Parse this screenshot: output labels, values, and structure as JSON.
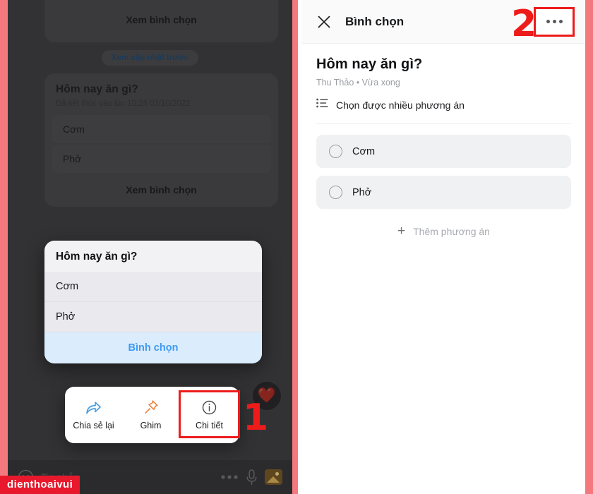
{
  "annotations": {
    "step_one": "1",
    "step_two": "2",
    "accent_color": "#ee1b1b"
  },
  "watermark": {
    "text": "dienthoaivui",
    "bg": "#e8192c",
    "fg": "#ffffff"
  },
  "left_panel": {
    "theme": "dark-dimmed",
    "background": "#323234",
    "top_card": {
      "action_label": "Xem bình chọn"
    },
    "system_pill": {
      "label": "Xem cập nhật trước"
    },
    "ended_poll": {
      "title": "Hôm nay ăn gì?",
      "subtitle": "Đã kết thúc vào lúc 10:24 03/10/2022",
      "options": [
        "Cơm",
        "Phở"
      ],
      "action_label": "Xem bình chọn"
    },
    "raised_poll": {
      "title": "Hôm nay ăn gì?",
      "options": [
        "Cơm",
        "Phở"
      ],
      "vote_label": "Bình chọn",
      "vote_color": "#3e9bf3"
    },
    "reaction": {
      "emoji": "❤️",
      "name": "heart-reaction"
    },
    "context_menu": {
      "items": [
        {
          "label": "Chia sẻ lại",
          "icon": "share-arrow-icon",
          "color": "#4a9de0",
          "highlighted": false
        },
        {
          "label": "Ghim",
          "icon": "pin-icon",
          "color": "#ef7f3a",
          "highlighted": false
        },
        {
          "label": "Chi tiết",
          "icon": "info-circle-icon",
          "color": "#46474a",
          "highlighted": true
        }
      ]
    },
    "bottom_bar": {
      "emoji_icon": "smiley-icon",
      "input_placeholder": "Tin nhắn",
      "more_icon": "more-options-icon",
      "mic_icon": "microphone-icon",
      "image_icon": "photo-icon"
    }
  },
  "right_panel": {
    "header": {
      "close_icon": "close-icon",
      "title": "Bình chọn",
      "more_icon": "more-options-icon"
    },
    "poll": {
      "question": "Hôm nay ăn gì?",
      "author": "Thu Thảo",
      "separator": "•",
      "time": "Vừa xong",
      "meta": "Thu Thảo • Vừa xong",
      "mode_icon": "list-icon",
      "mode_label": "Chọn được nhiều phương án",
      "options": [
        {
          "label": "Cơm",
          "selected": false
        },
        {
          "label": "Phở",
          "selected": false
        }
      ],
      "add_option_label": "Thêm phương án",
      "add_option_icon": "plus-icon"
    }
  }
}
